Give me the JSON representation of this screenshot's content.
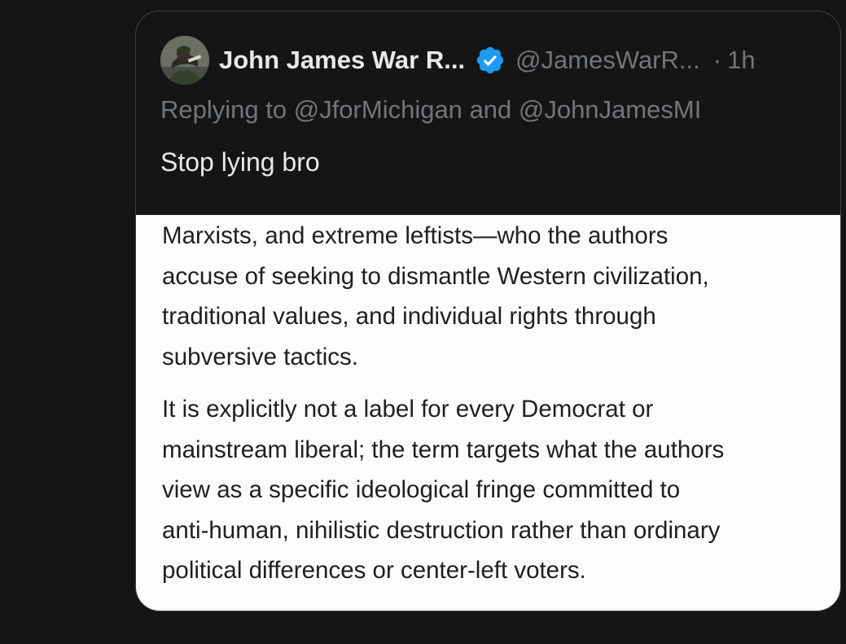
{
  "quoted_post": {
    "author": {
      "display_name": "John James War R...",
      "handle": "@JamesWarR...",
      "verified": true,
      "avatar_icon": "user-avatar-photo"
    },
    "separator": "·",
    "time": "1h",
    "replying_prefix": "Replying to",
    "replying_to": [
      "@JforMichigan",
      "@JohnJamesMI"
    ],
    "replying_joiner": "and",
    "text": "Stop lying bro",
    "attached_image": {
      "paragraphs": [
        {
          "lines": [
            "Marxists, and extreme leftists—who the authors",
            "accuse of seeking to dismantle Western civilization,",
            "traditional values, and individual rights through",
            "subversive tactics."
          ]
        },
        {
          "lines": [
            "It is explicitly not a label for every Democrat or",
            "mainstream liberal; the term targets what the authors",
            "view as a specific ideological fringe committed to",
            "anti-human, nihilistic destruction rather than ordinary",
            "political differences or center-left voters."
          ]
        }
      ]
    }
  },
  "colors": {
    "background": "#151515",
    "primary_text": "#e7e9ea",
    "secondary_text": "#71767b",
    "verified_blue": "#1d9bf0",
    "card_border": "#3e4144",
    "image_background": "#fcfcfc",
    "image_text": "#1f1f1f"
  }
}
